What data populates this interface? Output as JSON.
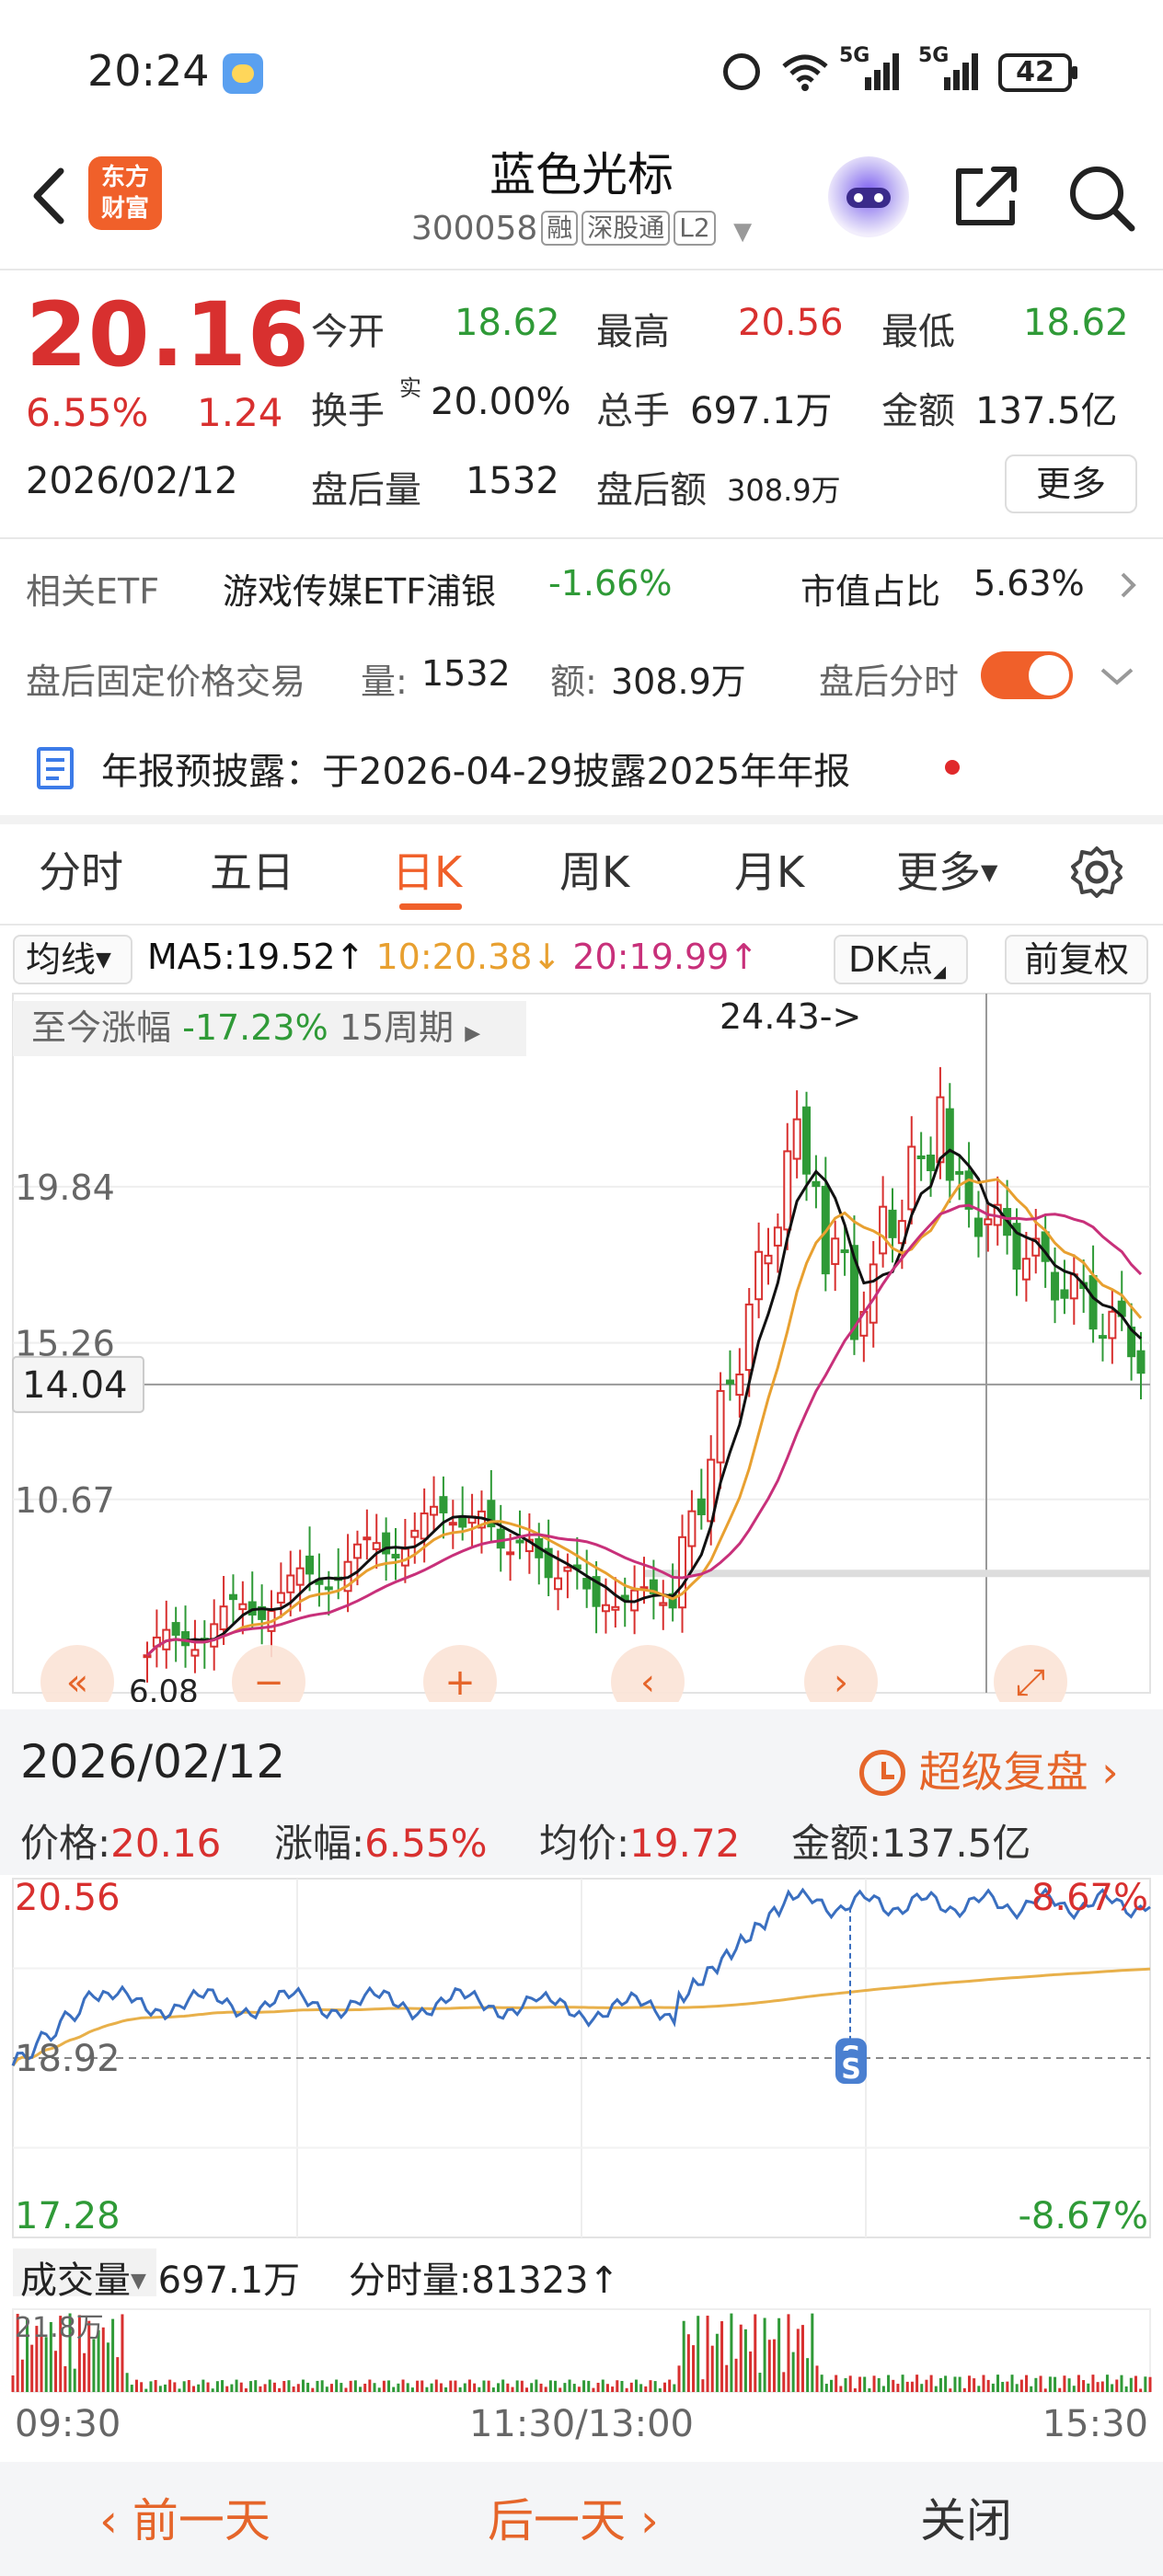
{
  "status_bar": {
    "time": "20:24",
    "network_1": "5G",
    "network_2": "5G",
    "battery": "42"
  },
  "header": {
    "logo_text_1": "东方",
    "logo_text_2": "财富",
    "stock_name": "蓝色光标",
    "stock_code": "300058",
    "tags": [
      "融",
      "深股通",
      "L2"
    ]
  },
  "quote": {
    "price": "20.16",
    "change_pct": "6.55%",
    "change_val": "1.24",
    "date": "2026/02/12",
    "open_label": "今开",
    "open": "18.62",
    "high_label": "最高",
    "high": "20.56",
    "low_label": "最低",
    "low": "18.62",
    "turnover_label": "换手",
    "turnover_sup": "实",
    "turnover": "20.00%",
    "volume_label": "总手",
    "volume": "697.1万",
    "amount_label": "金额",
    "amount": "137.5亿",
    "after_vol_label": "盘后量",
    "after_vol": "1532",
    "after_amt_label": "盘后额",
    "after_amt": "308.9万",
    "more_label": "更多"
  },
  "etf": {
    "label": "相关ETF",
    "name": "游戏传媒ETF浦银",
    "change": "-1.66%",
    "weight_label": "市值占比",
    "weight": "5.63%"
  },
  "after_hours": {
    "label": "盘后固定价格交易",
    "vol_label": "量:",
    "vol": "1532",
    "amt_label": "额:",
    "amt": "308.9万",
    "toggle_label": "盘后分时"
  },
  "notice": {
    "text": "年报预披露：于2026-04-29披露2025年年报"
  },
  "tabs": [
    "分时",
    "五日",
    "日K",
    "周K",
    "月K",
    "更多"
  ],
  "active_tab": "日K",
  "kline_toolbar": {
    "indicator": "均线",
    "ma5": "MA5:19.52↑",
    "ma10": "10:20.38↓",
    "ma20": "20:19.99↑",
    "dk_label": "DK点",
    "adjust_label": "前复权"
  },
  "kline": {
    "period_label": "至今涨幅",
    "period_value": "-17.23%",
    "period_count": "15周期",
    "max_label": "24.43->",
    "y_labels": [
      "19.84",
      "15.26",
      "10.67"
    ],
    "crosshair_price": "14.04",
    "min_label": "6.08"
  },
  "detail": {
    "date": "2026/02/12",
    "replay_label": "超级复盘",
    "price_label": "价格:",
    "price": "20.16",
    "chg_label": "涨幅:",
    "chg": "6.55%",
    "avg_label": "均价:",
    "avg": "19.72",
    "amt_label": "金额:",
    "amt": "137.5亿"
  },
  "intraday": {
    "y_top": "20.56",
    "y_mid": "18.92",
    "y_bottom": "17.28",
    "pct_top": "8.67%",
    "pct_bottom": "-8.67%",
    "vol_label": "成交量",
    "vol_total": "697.1万",
    "tick_vol_label": "分时量:81323↑",
    "vol_max": "21.8万",
    "time_start": "09:30",
    "time_mid": "11:30/13:00",
    "time_end": "15:30"
  },
  "bottom_nav": {
    "prev": "前一天",
    "next": "后一天",
    "close": "关闭"
  },
  "colors": {
    "up": "#d8302f",
    "down": "#2f9a37",
    "accent": "#f0602a",
    "ma5": "#111111",
    "ma10": "#e8a030",
    "ma20": "#c8307a",
    "price_line": "#3a6fc0",
    "avg_line": "#e8b04a"
  }
}
